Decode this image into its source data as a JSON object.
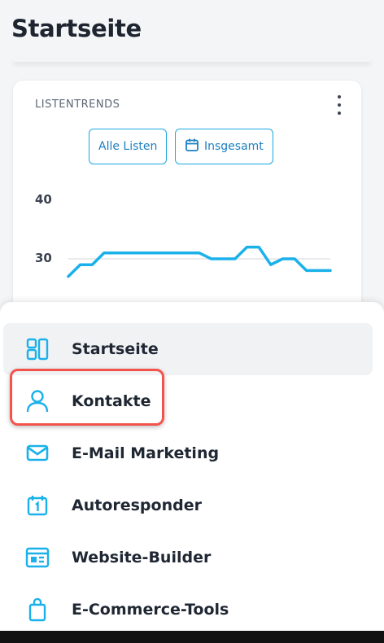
{
  "page": {
    "title": "Startseite"
  },
  "card": {
    "title": "LISTENTRENDS",
    "menu_icon": "kebab-vertical-icon",
    "buttons": {
      "all_lists": "Alle Listen",
      "total": "Insgesamt",
      "total_icon": "calendar-icon"
    }
  },
  "chart_data": {
    "type": "line",
    "yticks": [
      "40",
      "30"
    ],
    "ylim": [
      25,
      42
    ],
    "gridline_at": 30,
    "series": [
      {
        "color": "#1ab1ea",
        "values": [
          27,
          29,
          29,
          31,
          31,
          31,
          31,
          31,
          31,
          31,
          31,
          31,
          30,
          30,
          30,
          32,
          32,
          29,
          30,
          30,
          28,
          28,
          28
        ]
      }
    ]
  },
  "nav": {
    "items": [
      {
        "label": "Startseite",
        "icon": "dashboard-icon",
        "active": true
      },
      {
        "label": "Kontakte",
        "icon": "user-icon",
        "active": false
      },
      {
        "label": "E-Mail Marketing",
        "icon": "envelope-icon",
        "active": false
      },
      {
        "label": "Autoresponder",
        "icon": "calendar-one-icon",
        "active": false
      },
      {
        "label": "Website-Builder",
        "icon": "website-icon",
        "active": false
      },
      {
        "label": "E-Commerce-Tools",
        "icon": "shopping-bag-icon",
        "active": false
      }
    ]
  },
  "colors": {
    "accent": "#1ab1ea",
    "highlight": "#f2544d"
  }
}
